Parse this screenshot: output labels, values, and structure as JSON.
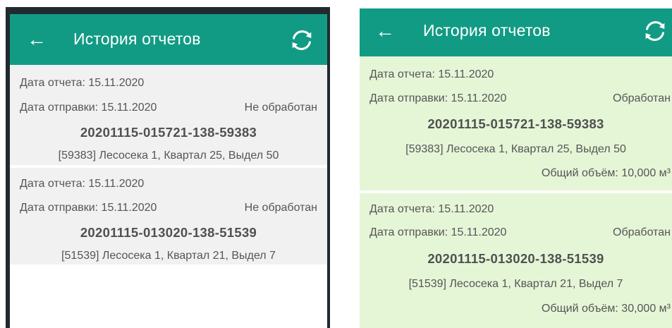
{
  "screens": [
    {
      "toolbar": {
        "title": "История отчетов",
        "back_icon": "arrow-left-icon",
        "refresh_icon": "refresh-icon",
        "color": "#129b84"
      },
      "card_color": "#f1f1f1",
      "reports": [
        {
          "report_date": "Дата отчета: 15.11.2020",
          "sent_date": "Дата отправки: 15.11.2020",
          "status": "Не обработан",
          "number": "20201115-015721-138-59383",
          "location": "[59383] Лесосека 1, Квартал 25, Выдел 50"
        },
        {
          "report_date": "Дата отчета: 15.11.2020",
          "sent_date": "Дата отправки: 15.11.2020",
          "status": "Не обработан",
          "number": "20201115-013020-138-51539",
          "location": "[51539] Лесосека 1, Квартал 21, Выдел 7"
        }
      ]
    },
    {
      "toolbar": {
        "title": "История отчетов",
        "back_icon": "arrow-left-icon",
        "refresh_icon": "refresh-icon",
        "color": "#129b84"
      },
      "card_color": "#e5f6d7",
      "reports": [
        {
          "report_date": "Дата отчета: 15.11.2020",
          "sent_date": "Дата отправки: 15.11.2020",
          "status": "Обработан",
          "number": "20201115-015721-138-59383",
          "location": "[59383] Лесосека 1, Квартал 25, Выдел 50",
          "volume": "Общий объём: 10,000 м³"
        },
        {
          "report_date": "Дата отчета: 15.11.2020",
          "sent_date": "Дата отправки: 15.11.2020",
          "status": "Обработан",
          "number": "20201115-013020-138-51539",
          "location": "[51539] Лесосека 1, Квартал 21, Выдел 7",
          "volume": "Общий объём: 30,000 м³"
        }
      ]
    }
  ]
}
